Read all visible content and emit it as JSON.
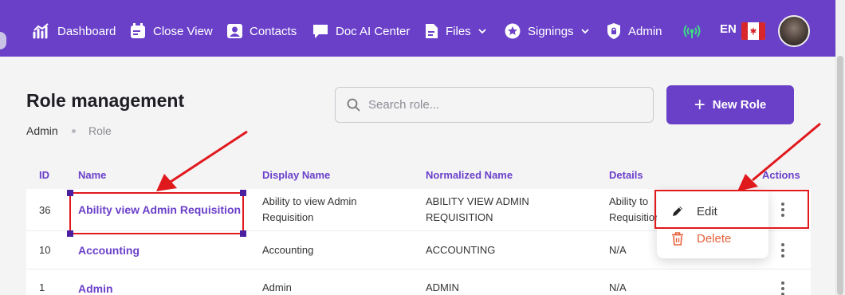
{
  "nav": {
    "items": [
      {
        "label": "Dashboard",
        "icon": "chart-icon"
      },
      {
        "label": "Close View",
        "icon": "calendar-icon"
      },
      {
        "label": "Contacts",
        "icon": "contact-icon"
      },
      {
        "label": "Doc AI Center",
        "icon": "chat-icon"
      },
      {
        "label": "Files",
        "icon": "file-icon",
        "dropdown": true
      },
      {
        "label": "Signings",
        "icon": "star-badge-icon",
        "dropdown": true
      },
      {
        "label": "Admin",
        "icon": "lock-icon"
      }
    ],
    "broadcast_icon_color": "#3ddc84",
    "language": "EN",
    "flag": "canada-flag-icon"
  },
  "page": {
    "title": "Role management",
    "breadcrumb": [
      "Admin",
      "Role"
    ]
  },
  "search": {
    "placeholder": "Search role..."
  },
  "new_role_label": "New Role",
  "table": {
    "headers": {
      "id": "ID",
      "name": "Name",
      "display_name": "Display Name",
      "normalized_name": "Normalized Name",
      "details": "Details",
      "actions": "Actions"
    },
    "rows": [
      {
        "id": "36",
        "name": "Ability view Admin Requisition",
        "display_name": [
          "Ability to view Admin",
          "Requisition"
        ],
        "normalized_name": [
          "ABILITY VIEW ADMIN",
          "REQUISITION"
        ],
        "details": [
          "Ability to",
          "Requisition"
        ]
      },
      {
        "id": "10",
        "name": "Accounting",
        "display_name": [
          "Accounting"
        ],
        "normalized_name": [
          "ACCOUNTING"
        ],
        "details": [
          "N/A"
        ]
      },
      {
        "id": "1",
        "name": "Admin",
        "display_name": [
          "Admin"
        ],
        "normalized_name": [
          "ADMIN"
        ],
        "details": [
          "N/A"
        ]
      }
    ]
  },
  "actions_menu": {
    "edit_label": "Edit",
    "delete_label": "Delete"
  },
  "colors": {
    "brand": "#6a40c9",
    "annotation_red": "#e0191d",
    "delete": "#e5623a"
  }
}
